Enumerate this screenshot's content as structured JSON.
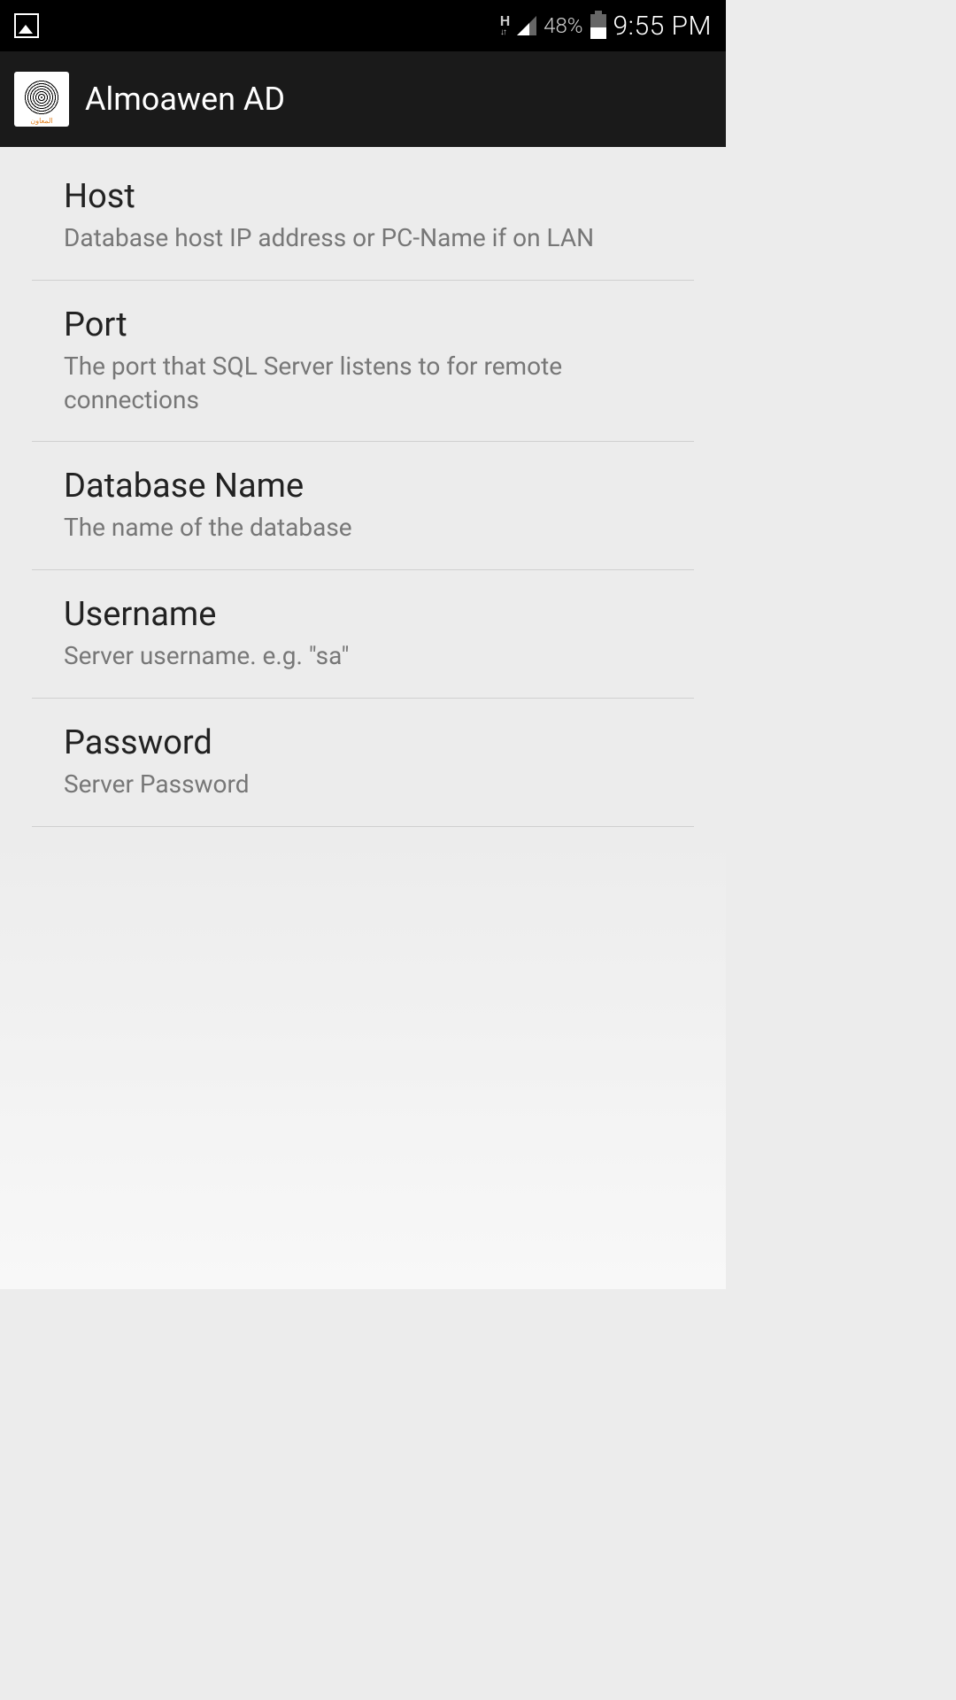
{
  "status_bar": {
    "network_type": "H",
    "battery_percent": "48%",
    "time": "9:55 PM"
  },
  "app_bar": {
    "title": "Almoawen AD",
    "icon_label": "المعاون"
  },
  "settings": [
    {
      "title": "Host",
      "description": "Database host IP address or PC-Name if on LAN"
    },
    {
      "title": "Port",
      "description": "The port that SQL Server listens to for remote connections"
    },
    {
      "title": "Database Name",
      "description": "The name of the database"
    },
    {
      "title": "Username",
      "description": "Server username. e.g. \"sa\""
    },
    {
      "title": "Password",
      "description": "Server Password"
    }
  ]
}
